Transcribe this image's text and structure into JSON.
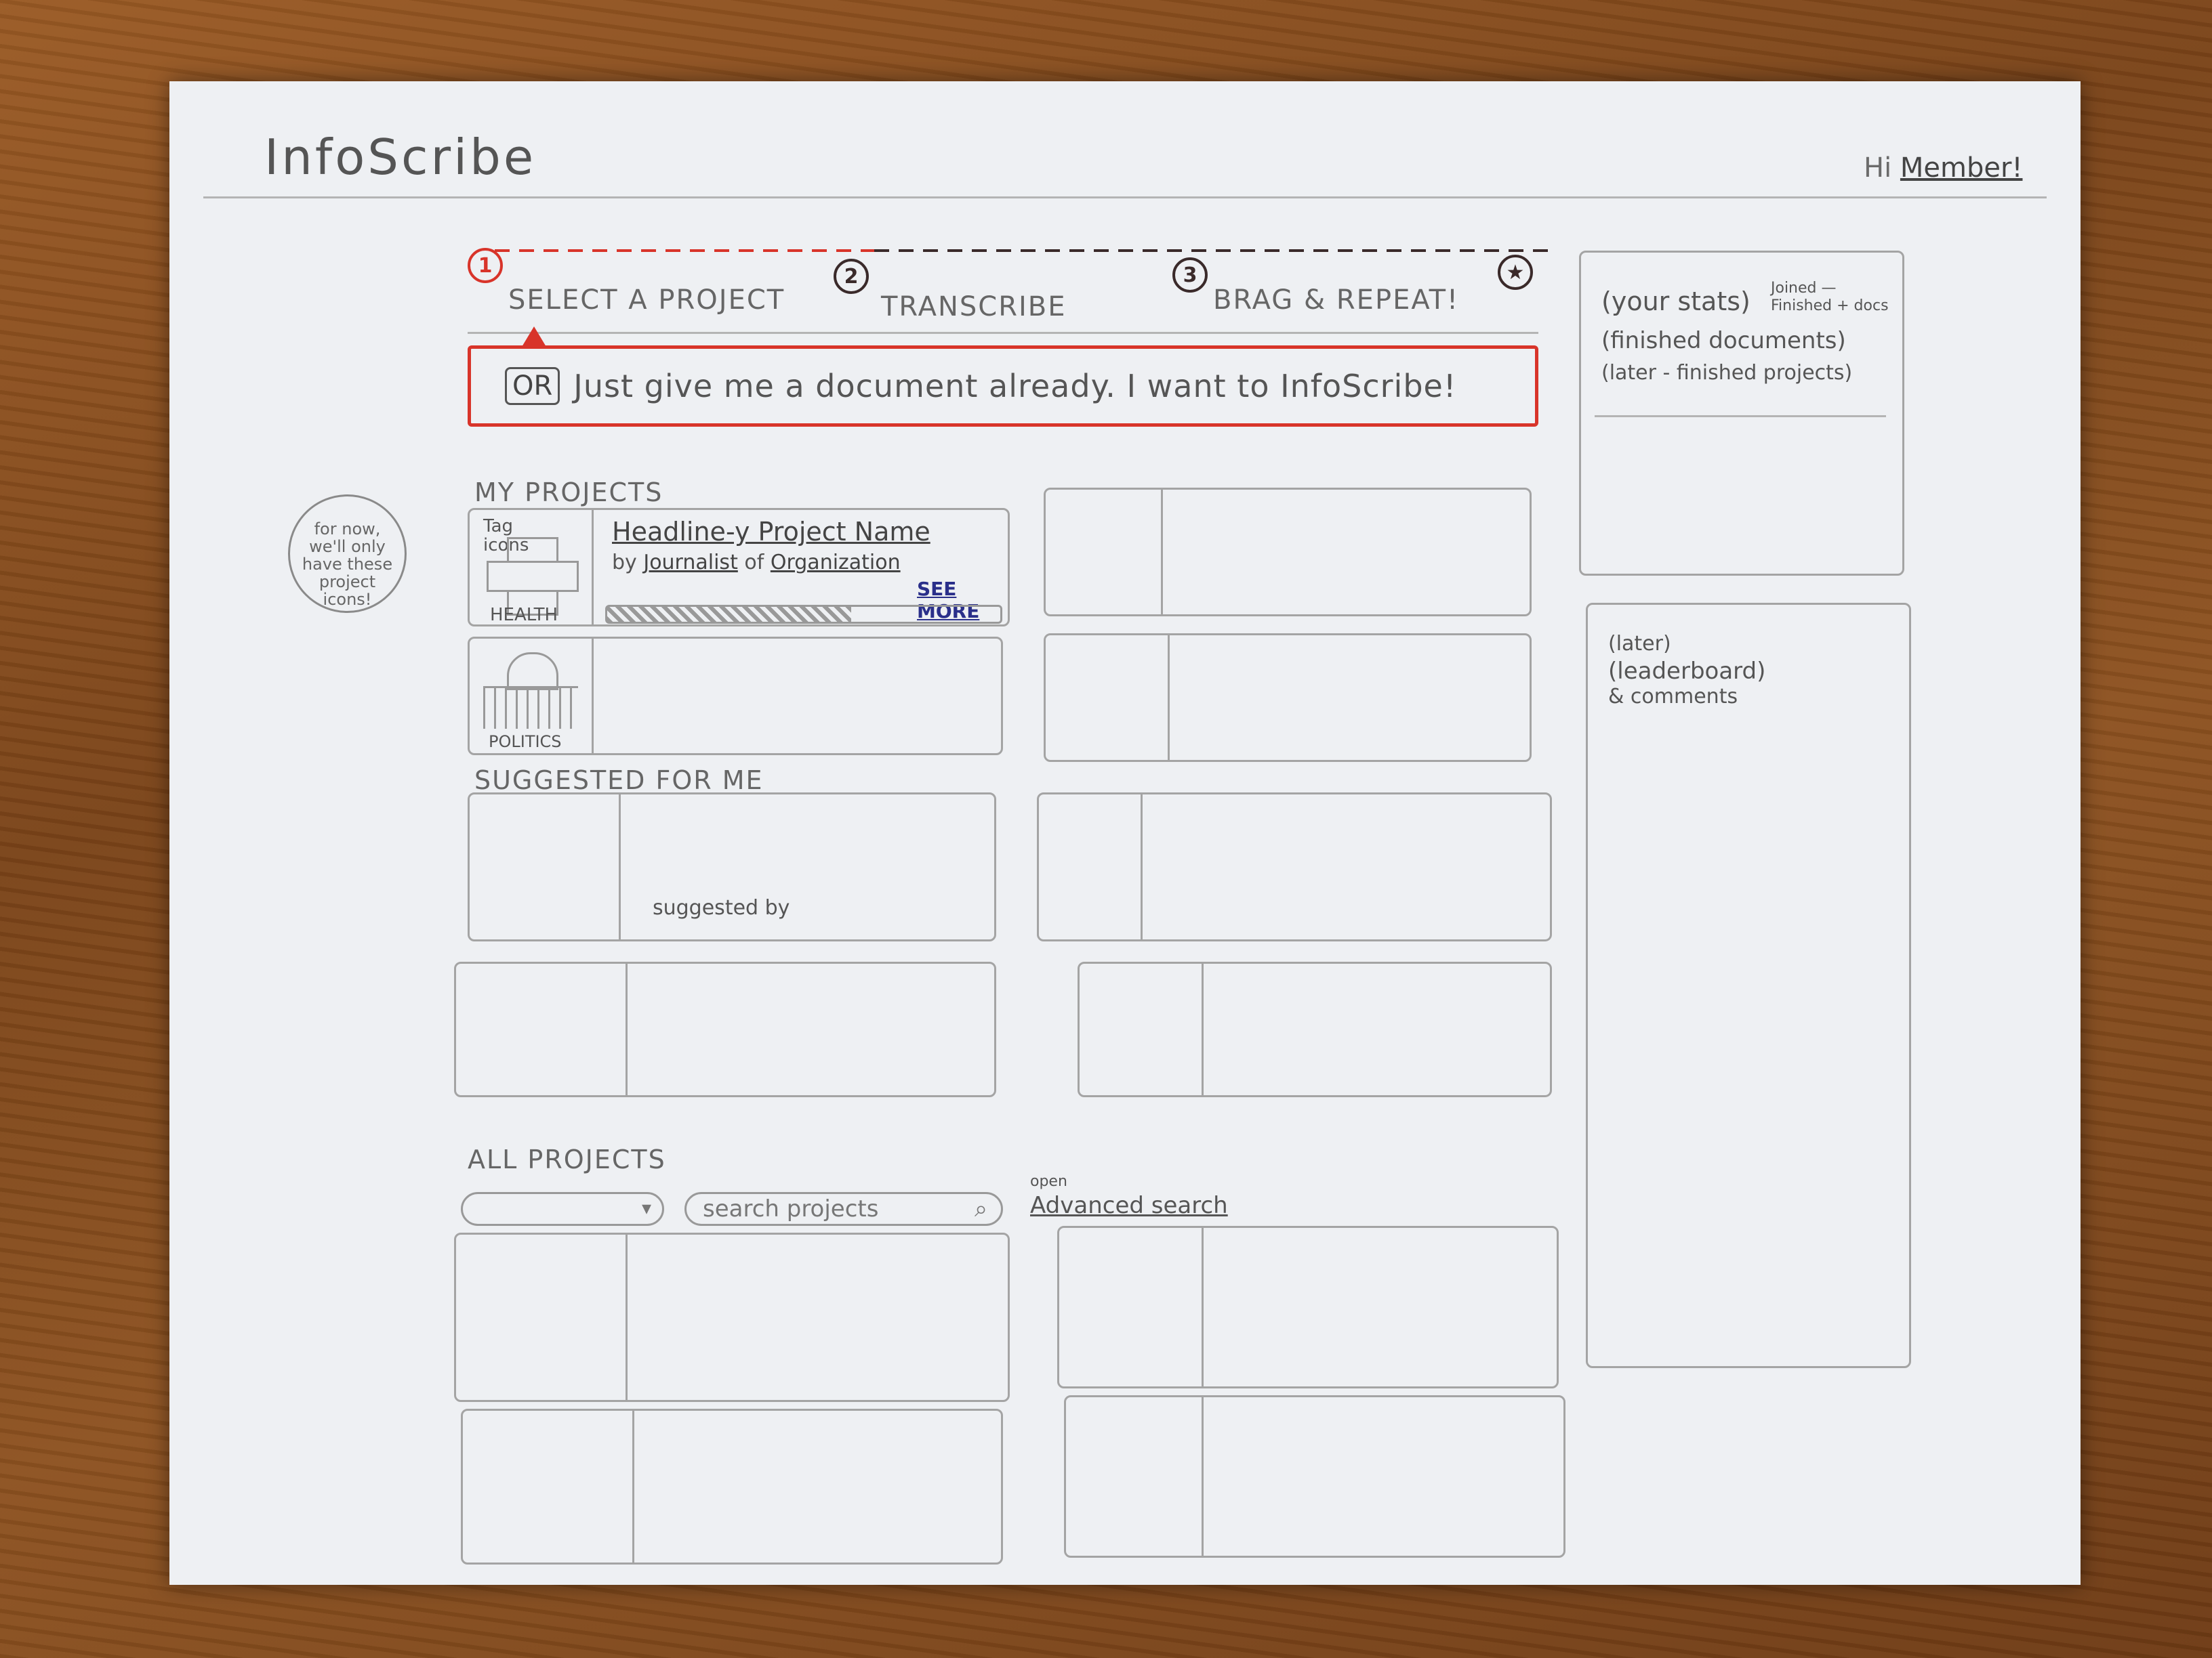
{
  "app": {
    "title": "InfoScribe",
    "greeting_prefix": "Hi",
    "member_link": "Member!"
  },
  "steps": [
    {
      "number": "1",
      "label": "SELECT A PROJECT",
      "active": true
    },
    {
      "number": "2",
      "label": "TRANSCRIBE"
    },
    {
      "number": "3",
      "label": "BRAG & REPEAT!"
    }
  ],
  "cta": {
    "or_label": "OR",
    "text": "Just give me a document already. I want to InfoScribe!"
  },
  "sidebar": {
    "stats_title": "(your stats)",
    "stats_note": "Joined — Finished + docs",
    "stats_lines": [
      "(finished documents)",
      "(later - finished projects)"
    ],
    "leaderboard_lines": [
      "(later)",
      "(leaderboard)",
      "& comments"
    ]
  },
  "side_note": "for now, we'll only have these project icons!",
  "my_projects": {
    "title": "MY PROJECTS",
    "card1": {
      "icon_label": "Tag icons",
      "category": "HEALTH",
      "headline": "Headline-y Project Name",
      "by": "by",
      "journalist": "Journalist",
      "of": "of",
      "organization": "Organization",
      "see_more": "SEE MORE",
      "progress": 0.62
    },
    "card2": {
      "category": "POLITICS"
    }
  },
  "suggested": {
    "title": "SUGGESTED FOR ME",
    "suggested_by": "suggested by"
  },
  "all_projects": {
    "title": "ALL PROJECTS",
    "search_placeholder": "search projects",
    "open_label": "open",
    "advanced_search": "Advanced search"
  },
  "colors": {
    "accent": "#d8342a",
    "ink": "#3a2a2a",
    "pencil": "#a4a4a4",
    "link": "#2a2f8a"
  },
  "icons": [
    "search-icon",
    "chevron-down-icon",
    "cross-icon",
    "capitol-icon",
    "finish-icon"
  ]
}
